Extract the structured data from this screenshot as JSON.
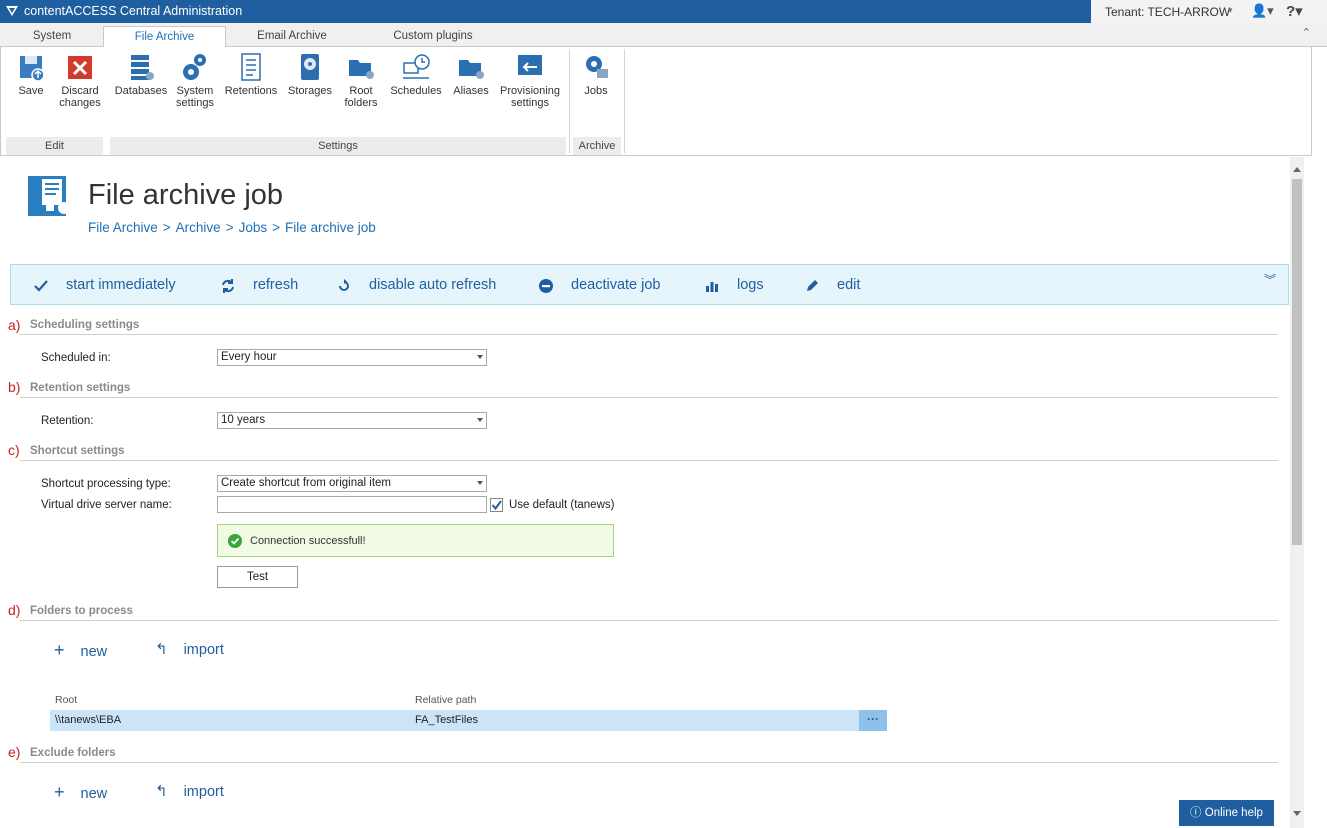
{
  "window": {
    "title": "contentACCESS Central Administration",
    "tenant": "Tenant: TECH-ARROW"
  },
  "tabs": [
    {
      "label": "System"
    },
    {
      "label": "File Archive"
    },
    {
      "label": "Email Archive"
    },
    {
      "label": "Custom plugins"
    }
  ],
  "ribbon": {
    "buttons": [
      {
        "label": "Save"
      },
      {
        "label": "Discard changes"
      },
      {
        "label": "Databases"
      },
      {
        "label": "System settings"
      },
      {
        "label": "Retentions"
      },
      {
        "label": "Storages"
      },
      {
        "label": "Root folders"
      },
      {
        "label": "Schedules"
      },
      {
        "label": "Aliases"
      },
      {
        "label": "Provisioning settings"
      },
      {
        "label": "Jobs"
      }
    ],
    "groups": {
      "edit": "Edit",
      "settings": "Settings",
      "archive": "Archive"
    }
  },
  "page": {
    "title": "File archive job",
    "breadcrumb": [
      "File Archive",
      "Archive",
      "Jobs",
      "File archive job"
    ]
  },
  "actions": [
    {
      "label": "start immediately"
    },
    {
      "label": "refresh"
    },
    {
      "label": "disable auto refresh"
    },
    {
      "label": "deactivate job"
    },
    {
      "label": "logs"
    },
    {
      "label": "edit"
    }
  ],
  "sections": {
    "a": {
      "marker": "a)",
      "title": "Scheduling settings",
      "label": "Scheduled in:",
      "value": "Every hour"
    },
    "b": {
      "marker": "b)",
      "title": "Retention settings",
      "label": "Retention:",
      "value": "10 years"
    },
    "c": {
      "marker": "c)",
      "title": "Shortcut settings",
      "type_label": "Shortcut processing type:",
      "type_value": "Create shortcut from original item",
      "server_label": "Virtual drive server name:",
      "server_value": "",
      "use_default": "Use default (tanews)",
      "message": "Connection successfull!",
      "test": "Test"
    },
    "d": {
      "marker": "d)",
      "title": "Folders to process",
      "new": "new",
      "import": "import",
      "columns": [
        "Root",
        "Relative path"
      ],
      "rows": [
        {
          "root": "\\\\tanews\\EBA",
          "path": "FA_TestFiles"
        }
      ]
    },
    "e": {
      "marker": "e)",
      "title": "Exclude folders",
      "new": "new",
      "import": "import"
    }
  },
  "online_help": "Online help",
  "colors": {
    "accent": "#1f5f9f",
    "titlebar": "#1f5fa0",
    "marker": "#d02020",
    "success_border": "#a7d57a"
  }
}
